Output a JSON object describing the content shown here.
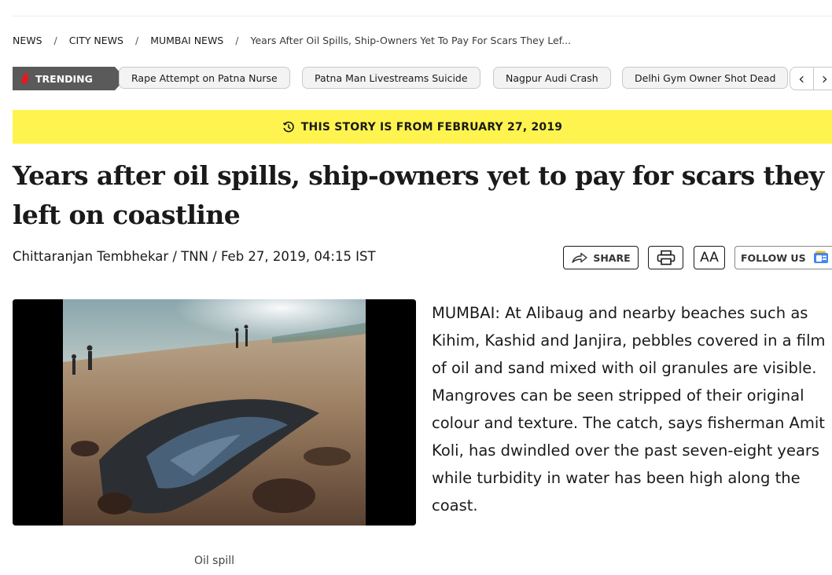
{
  "breadcrumb": {
    "items": [
      "NEWS",
      "CITY NEWS",
      "MUMBAI NEWS"
    ],
    "separator": "/",
    "current": "Years After Oil Spills, Ship-Owners Yet To Pay For Scars They Lef..."
  },
  "trending": {
    "label": "TRENDING",
    "items": [
      "Rape Attempt on Patna Nurse",
      "Patna Man Livestreams Suicide",
      "Nagpur Audi Crash",
      "Delhi Gym Owner Shot Dead"
    ],
    "prev_icon": "chevron-left-icon",
    "next_icon": "chevron-right-icon"
  },
  "story_banner": {
    "text": "THIS STORY IS FROM FEBRUARY 27, 2019",
    "icon": "history-clock-icon",
    "color": "#fff44f"
  },
  "article": {
    "headline": "Years after oil spills, ship-owners yet to pay for scars they left on coastline",
    "byline": "Chittaranjan Tembhekar / TNN / Feb 27, 2019, 04:15 IST",
    "image_caption": "Oil spill",
    "body": "MUMBAI: At Alibaug and nearby beaches such as Kihim, Kashid and Janjira, pebbles covered in a film of oil and sand mixed with oil granules are visible. Mangroves can be seen stripped of their original colour and texture. The catch, says fisherman Amit Koli, has dwindled over the past seven-eight years while turbidity in water has been high along the coast."
  },
  "tools": {
    "share_label": "SHARE",
    "print_icon": "printer-icon",
    "font_size_label": "AA",
    "follow_label": "FOLLOW US",
    "follow_icon": "google-news-icon"
  }
}
